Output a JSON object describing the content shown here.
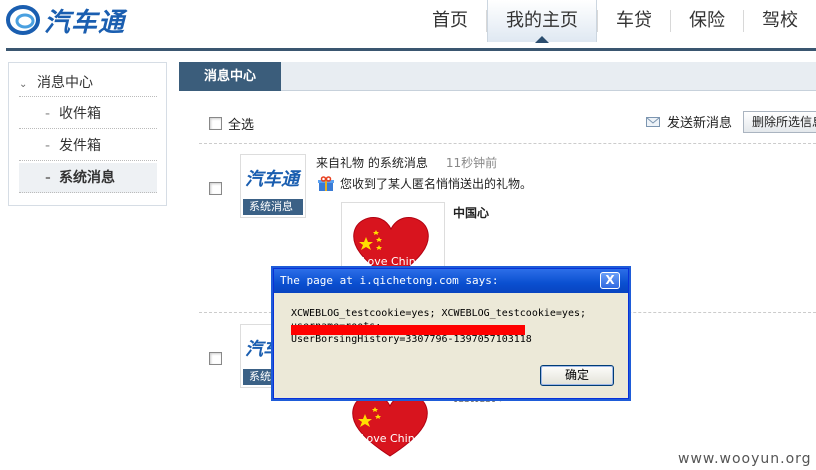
{
  "header": {
    "logo_text": "汽车通",
    "nav": [
      "首页",
      "我的主页",
      "车贷",
      "保险",
      "驾校"
    ],
    "active_nav": "我的主页"
  },
  "sidebar": {
    "heading": "消息中心",
    "items": [
      {
        "label": "收件箱"
      },
      {
        "label": "发件箱"
      },
      {
        "label": "系统消息",
        "active": true
      }
    ]
  },
  "main": {
    "tab": "消息中心",
    "select_all": "全选",
    "new_message": "发送新消息",
    "delete_selected": "删除所选信息",
    "messages": [
      {
        "avatar_logo": "汽车通",
        "avatar_tag": "系统消息",
        "from": "来自礼物 的系统消息",
        "time": "11秒钟前",
        "body": "您收到了某人匿名悄悄送出的礼物。",
        "gift_name": "中国心",
        "gift_text": "Love China"
      },
      {
        "avatar_logo": "汽车通",
        "avatar_tag": "系统",
        "gift_text": "Love China",
        "tail": "testtest >"
      }
    ]
  },
  "dialog": {
    "title": "The page at i.qichetong.com says:",
    "line1": "XCWEBLOG_testcookie=yes; XCWEBLOG_testcookie=yes;",
    "line2": "username=roots;",
    "line3": "UserBorsingHistory=3307796-1397057103118",
    "ok": "确定",
    "close": "X"
  },
  "watermark": "www.wooyun.org",
  "colors": {
    "brand": "#1a5eb0",
    "tab_bg": "#3b5d7b",
    "dialog_title": "#0a4fd0",
    "redaction": "#ff0000"
  }
}
